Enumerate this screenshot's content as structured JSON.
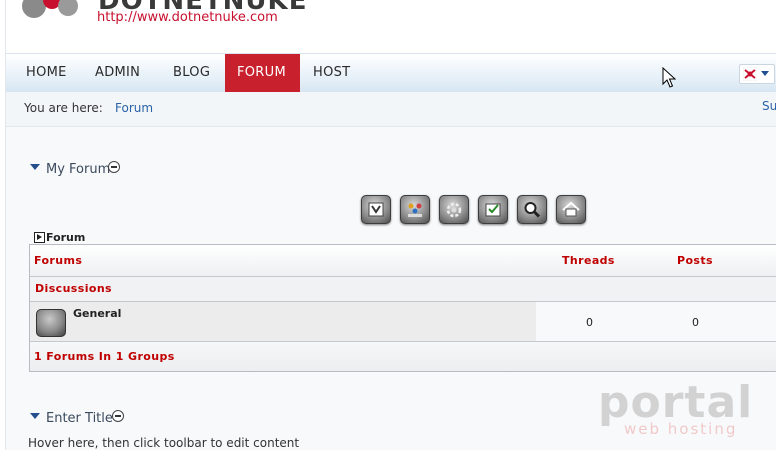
{
  "header": {
    "logo_text": "DOTNETNUKE",
    "logo_url": "http://www.dotnetnuke.com"
  },
  "nav": {
    "items": [
      {
        "label": "HOME"
      },
      {
        "label": "ADMIN"
      },
      {
        "label": "BLOG"
      },
      {
        "label": "FORUM",
        "active": true
      },
      {
        "label": "HOST"
      }
    ],
    "language_icon": "flag-icon"
  },
  "breadcrumb": {
    "label": "You are here:",
    "current": "Forum",
    "right_link": "Su"
  },
  "module_forum": {
    "title": "My Forum",
    "toolbar_icons": [
      "subscribe-icon",
      "users-icon",
      "settings-icon",
      "my-posts-icon",
      "search-icon",
      "home-icon"
    ],
    "sub_label": "Forum",
    "table": {
      "columns": [
        "Forums",
        "Threads",
        "Posts"
      ],
      "group": "Discussions",
      "forums": [
        {
          "name": "General",
          "threads": "0",
          "posts": "0"
        }
      ],
      "footer": "1 Forums In 1 Groups"
    }
  },
  "module_enter": {
    "title": "Enter Title",
    "hint": "Hover here, then click toolbar to edit content"
  },
  "watermark": {
    "big": "portal",
    "small": "web hosting"
  },
  "colors": {
    "accent_red": "#c8202d",
    "link_blue": "#2a62a8"
  }
}
